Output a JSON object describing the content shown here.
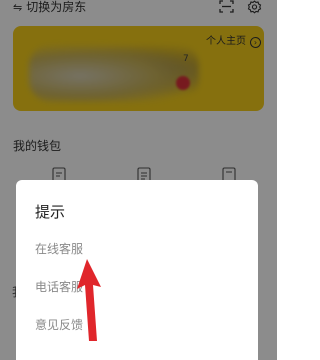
{
  "header": {
    "switch_icon": "switch-arrows-icon",
    "switch_label": "切换为房东",
    "icons": [
      "scan-icon",
      "gear-icon"
    ]
  },
  "profile_card": {
    "homepage_label": "个人主页",
    "homepage_icon": "circle-chevron-right-icon",
    "partial_digit": "7",
    "background_color": "#f4cd1b"
  },
  "wallet": {
    "title": "我的钱包"
  },
  "partial_background_text": "我",
  "dialog": {
    "title": "提示",
    "options": [
      {
        "label": "在线客服"
      },
      {
        "label": "电话客服"
      },
      {
        "label": "意见反馈"
      }
    ]
  },
  "annotation": {
    "pointer_color": "#e0262b"
  }
}
